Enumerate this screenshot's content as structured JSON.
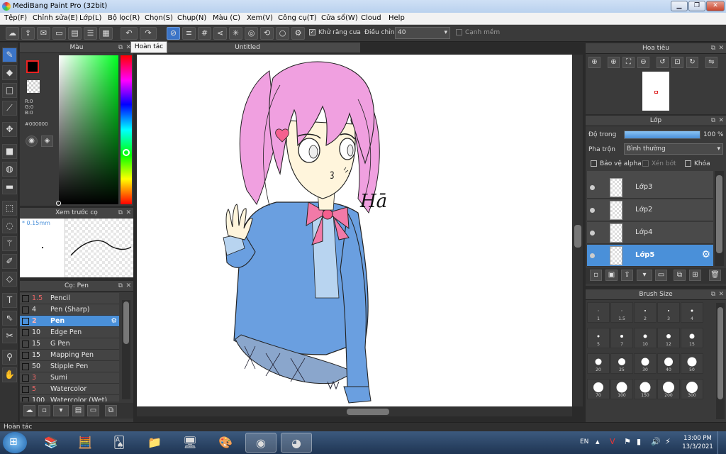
{
  "window": {
    "title": "MediBang Paint Pro (32bit)",
    "min": "▁",
    "max": "❐",
    "close": "✕"
  },
  "menu": [
    "Tệp(F)",
    "Chỉnh sửa(E)",
    "Lớp(L)",
    "Bộ lọc(R)",
    "Chọn(S)",
    "Chụp(N)",
    "Màu (C)",
    "Xem(V)",
    "Công cụ(T)",
    "Cửa sổ(W)",
    "Cloud",
    "Help"
  ],
  "toolbar": {
    "antialias_label": "Khử răng cưa",
    "adjust_label": "Điều chỉnh",
    "adjust_value": "40",
    "smooth_edge_label": "Cạnh mềm",
    "tooltip": "Hoàn tác"
  },
  "color_panel": {
    "title": "Màu",
    "r": "R:0",
    "g": "G:0",
    "b": "B:0",
    "hex": "#000000",
    "primary": "#000000",
    "secondary": "#ffffff"
  },
  "preview_panel": {
    "title": "Xem trước cọ",
    "size": "* 0.15mm"
  },
  "brush_panel": {
    "title": "Cọ: Pen",
    "brushes": [
      {
        "size": "1.5",
        "name": "Pencil",
        "color": "#333333"
      },
      {
        "size": "4",
        "name": "Pen (Sharp)",
        "color": "#333333"
      },
      {
        "size": "2",
        "name": "Pen",
        "color": "#333333"
      },
      {
        "size": "10",
        "name": "Edge Pen",
        "color": "#22aa22"
      },
      {
        "size": "15",
        "name": "G Pen",
        "color": "#dd2222"
      },
      {
        "size": "15",
        "name": "Mapping Pen",
        "color": "#dd2222"
      },
      {
        "size": "50",
        "name": "Stipple Pen",
        "color": "#dddd22"
      },
      {
        "size": "3",
        "name": "Sumi",
        "color": "#dddd22"
      },
      {
        "size": "5",
        "name": "Watercolor",
        "color": "#66ddee"
      },
      {
        "size": "100",
        "name": "Watercolor (Wet)",
        "color": "#66ddee"
      }
    ]
  },
  "canvas": {
    "tab_title": "Untitled",
    "signature": "Hā"
  },
  "navigator": {
    "title": "Hoa tiêu"
  },
  "layer_panel": {
    "title": "Lớp",
    "opacity_label": "Độ trong",
    "opacity_value": "100 %",
    "opacity": 1.0,
    "blend_label": "Pha trộn",
    "blend_value": "Bình thường",
    "protect_alpha": "Bảo vệ alpha",
    "clipping": "Xén bớt",
    "lock": "Khóa",
    "layers": [
      "Lớp3",
      "Lớp2",
      "Lớp4",
      "Lớp5"
    ],
    "selected": "Lớp5"
  },
  "brush_size_panel": {
    "title": "Brush Size",
    "sizes": [
      "1",
      "1.5",
      "2",
      "3",
      "4",
      "5",
      "7",
      "10",
      "12",
      "15",
      "20",
      "25",
      "30",
      "40",
      "50",
      "70",
      "100",
      "150",
      "200",
      "300"
    ]
  },
  "status": {
    "text": "Hoàn tác"
  },
  "taskbar": {
    "lang": "EN",
    "time": "13:00 PM",
    "date": "13/3/2021"
  }
}
